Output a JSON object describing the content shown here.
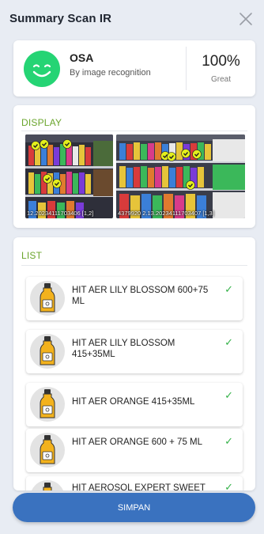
{
  "header": {
    "title": "Summary Scan IR"
  },
  "osa": {
    "label": "OSA",
    "method": "By image recognition",
    "percent": "100%",
    "grade": "Great",
    "color": "#25d474"
  },
  "display": {
    "title": "DISPLAY",
    "photos": [
      {
        "caption": "12.20234111703406 [1,2]"
      },
      {
        "caption": "4379920 2.13.20234111703407 [1,3]"
      }
    ]
  },
  "list": {
    "title": "LIST",
    "items": [
      {
        "name": "HIT AER LILY BLOSSOM 600+75 ML",
        "checked": "✓"
      },
      {
        "name": "HIT AER LILY BLOSSOM 415+35ML",
        "checked": "✓"
      },
      {
        "name": "HIT AER ORANGE 415+35ML",
        "checked": "✓"
      },
      {
        "name": "HIT AER ORANGE 600 + 75 ML",
        "checked": "✓"
      },
      {
        "name": "HIT AEROSOL EXPERT SWEET",
        "checked": "✓"
      }
    ]
  },
  "footer": {
    "save_label": "SIMPAN"
  },
  "colors": {
    "accent": "#3a72bf",
    "section_title": "#6aa52c",
    "check": "#35b249"
  }
}
